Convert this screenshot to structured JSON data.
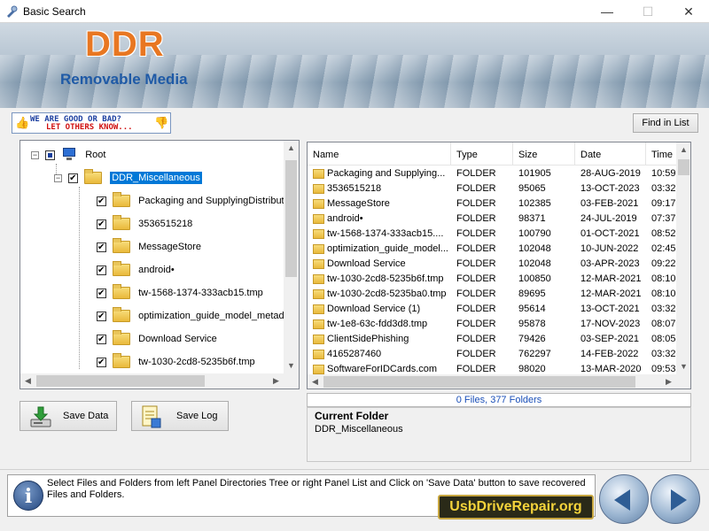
{
  "window": {
    "title": "Basic Search",
    "controls": {
      "minimize": "—",
      "maximize": "☐",
      "close": "✕"
    }
  },
  "banner": {
    "logo": "DDR",
    "subtitle": "Removable Media"
  },
  "feedback": {
    "line1": "WE ARE GOOD OR BAD?",
    "line2": "LET OTHERS KNOW..."
  },
  "toolbar": {
    "find_label": "Find in List"
  },
  "tree": {
    "root_label": "Root",
    "selected_label": "DDR_Miscellaneous",
    "items": [
      "Packaging and SupplyingDistribution",
      "3536515218",
      "MessageStore",
      "android•",
      "tw-1568-1374-333acb15.tmp",
      "optimization_guide_model_metadat",
      "Download Service",
      "tw-1030-2cd8-5235b6f.tmp"
    ]
  },
  "list": {
    "columns": [
      "Name",
      "Type",
      "Size",
      "Date",
      "Time"
    ],
    "rows": [
      [
        "Packaging and Supplying...",
        "FOLDER",
        "101905",
        "28-AUG-2019",
        "10:59"
      ],
      [
        "3536515218",
        "FOLDER",
        "95065",
        "13-OCT-2023",
        "03:32"
      ],
      [
        "MessageStore",
        "FOLDER",
        "102385",
        "03-FEB-2021",
        "09:17"
      ],
      [
        "android•",
        "FOLDER",
        "98371",
        "24-JUL-2019",
        "07:37"
      ],
      [
        "tw-1568-1374-333acb15....",
        "FOLDER",
        "100790",
        "01-OCT-2021",
        "08:52"
      ],
      [
        "optimization_guide_model...",
        "FOLDER",
        "102048",
        "10-JUN-2022",
        "02:45"
      ],
      [
        "Download Service",
        "FOLDER",
        "102048",
        "03-APR-2023",
        "09:22"
      ],
      [
        "tw-1030-2cd8-5235b6f.tmp",
        "FOLDER",
        "100850",
        "12-MAR-2021",
        "08:10"
      ],
      [
        "tw-1030-2cd8-5235ba0.tmp",
        "FOLDER",
        "89695",
        "12-MAR-2021",
        "08:10"
      ],
      [
        "Download Service (1)",
        "FOLDER",
        "95614",
        "13-OCT-2021",
        "03:32"
      ],
      [
        "tw-1e8-63c-fdd3d8.tmp",
        "FOLDER",
        "95878",
        "17-NOV-2023",
        "08:07"
      ],
      [
        "ClientSidePhishing",
        "FOLDER",
        "79426",
        "03-SEP-2021",
        "08:05"
      ],
      [
        "4165287460",
        "FOLDER",
        "762297",
        "14-FEB-2022",
        "03:32"
      ],
      [
        "SoftwareForIDCards.com",
        "FOLDER",
        "98020",
        "13-MAR-2020",
        "09:53"
      ]
    ]
  },
  "status": {
    "summary": "0 Files, 377 Folders"
  },
  "current_folder": {
    "heading": "Current Folder",
    "value": "DDR_Miscellaneous"
  },
  "actions": {
    "save_data": "Save Data",
    "save_log": "Save Log"
  },
  "info": {
    "message": "Select Files and Folders from left Panel Directories Tree or right Panel List and Click on 'Save Data' button to save recovered Files and Folders.",
    "icon_letter": "i"
  },
  "website": "UsbDriveRepair.org"
}
